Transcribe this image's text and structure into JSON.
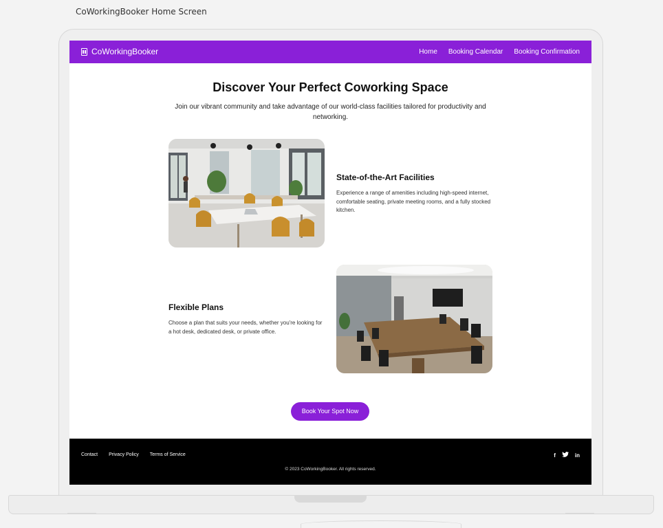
{
  "screen_caption": "CoWorkingBooker Home Screen",
  "navbar": {
    "brand_icon": "building-icon",
    "brand_name": "CoWorkingBooker",
    "links": [
      "Home",
      "Booking Calendar",
      "Booking Confirmation"
    ],
    "color": "#8a20d8"
  },
  "hero": {
    "title": "Discover Your Perfect Coworking Space",
    "subtitle": "Join our vibrant community and take advantage of our world-class facilities tailored for productivity and networking."
  },
  "features": [
    {
      "title": "State-of-the-Art Facilities",
      "text": "Experience a range of amenities including high-speed internet, comfortable seating, private meeting rooms, and a fully stocked kitchen.",
      "image": "open-workspace-photo"
    },
    {
      "title": "Flexible Plans",
      "text": "Choose a plan that suits your needs, whether you're looking for a hot desk, dedicated desk, or private office.",
      "image": "meeting-room-photo"
    }
  ],
  "cta": {
    "label": "Book Your Spot Now"
  },
  "footer": {
    "links": [
      "Contact",
      "Privacy Policy",
      "Terms of Service"
    ],
    "social": [
      {
        "icon": "facebook-icon",
        "glyph": "f"
      },
      {
        "icon": "twitter-icon",
        "glyph": "🐦"
      },
      {
        "icon": "linkedin-icon",
        "glyph": "in"
      }
    ],
    "copyright": "© 2023 CoWorkingBooker. All rights reserved."
  }
}
